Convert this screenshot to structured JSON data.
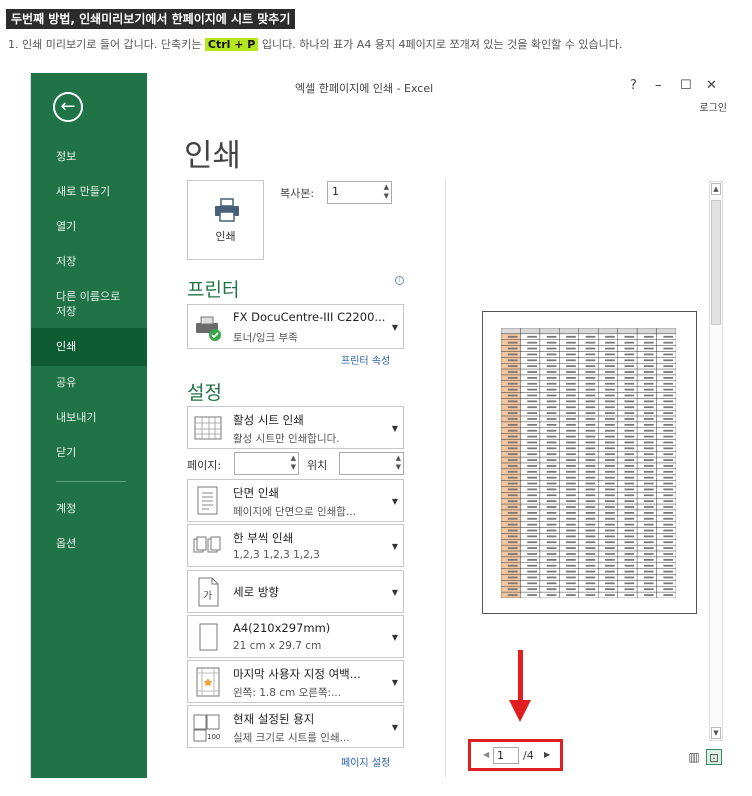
{
  "heading": "두번째 방법, 인쇄미리보기에서 한페이지에 시트 맞추기",
  "intro": {
    "before": "1. 인쇄 미리보기로 들어 갑니다. 단축키는 ",
    "shortcut": "Ctrl + P",
    "after": " 입니다. 하나의 표가 A4 용지 4페이지로 쪼개져 있는 것을 확인할 수 있습니다."
  },
  "window": {
    "title": "엑셀 한페이지에 인쇄 - Excel",
    "help": "?",
    "minimize": "–",
    "maximize": "☐",
    "close": "✕",
    "login": "로그인"
  },
  "sidebar": {
    "back": "←",
    "items": [
      "정보",
      "새로 만들기",
      "열기",
      "저장",
      "다른 이름으로 저장",
      "인쇄",
      "공유",
      "내보내기",
      "닫기",
      "계정",
      "옵션"
    ]
  },
  "print": {
    "page_title": "인쇄",
    "print_button": "인쇄",
    "copies_label": "복사본:",
    "copies_value": "1"
  },
  "printer": {
    "section": "프린터",
    "name": "FX DocuCentre-III C2200...",
    "status": "토너/잉크 부족",
    "properties_link": "프린터 속성"
  },
  "settings": {
    "section": "설정",
    "sheet_title": "활성 시트 인쇄",
    "sheet_desc": "활성 시트만 인쇄합니다.",
    "pages_label": "페이지:",
    "to_label": "위치",
    "sides_title": "단면 인쇄",
    "sides_desc": "페이지에 단면으로 인쇄합...",
    "collate_title": "한 부씩 인쇄",
    "collate_desc": "1,2,3    1,2,3    1,2,3",
    "orientation": "세로 방향",
    "paper_title": "A4(210x297mm)",
    "paper_desc": "21 cm x 29.7 cm",
    "margins_title": "마지막 사용자 지정 여백...",
    "margins_desc": "왼쪽:  1.8 cm     오른쪽:...",
    "scaling_title": "현재 설정된 용지",
    "scaling_desc": "실제 크기로 시트를 인쇄...",
    "page_setup_link": "페이지 설정"
  },
  "pager": {
    "current": "1",
    "total": "/4"
  },
  "colors": {
    "excel_green": "#207346",
    "active_green": "#0f5c32",
    "highlight": "#b5e61d",
    "callout_red": "#e02020"
  }
}
